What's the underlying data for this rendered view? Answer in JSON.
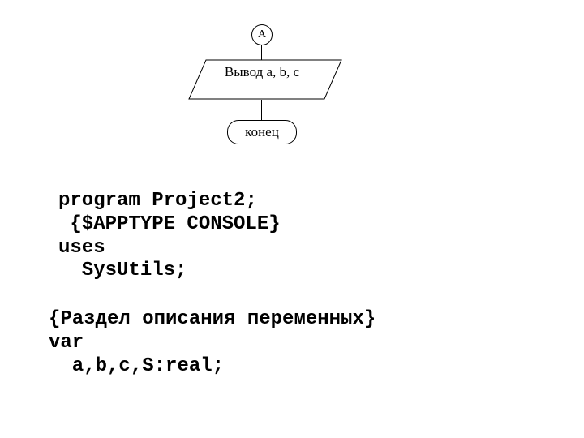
{
  "flowchart": {
    "connector_label": "A",
    "io_text": "Вывод a, b, c",
    "terminal_text": "конец"
  },
  "code1": {
    "l1": "program Project2;",
    "l2": " {$APPTYPE CONSOLE}",
    "l3": "uses",
    "l4": "  SysUtils;"
  },
  "code2": {
    "l1": "{Раздел описания переменных}",
    "l2": "var",
    "l3": "  a,b,c,S:real;"
  }
}
